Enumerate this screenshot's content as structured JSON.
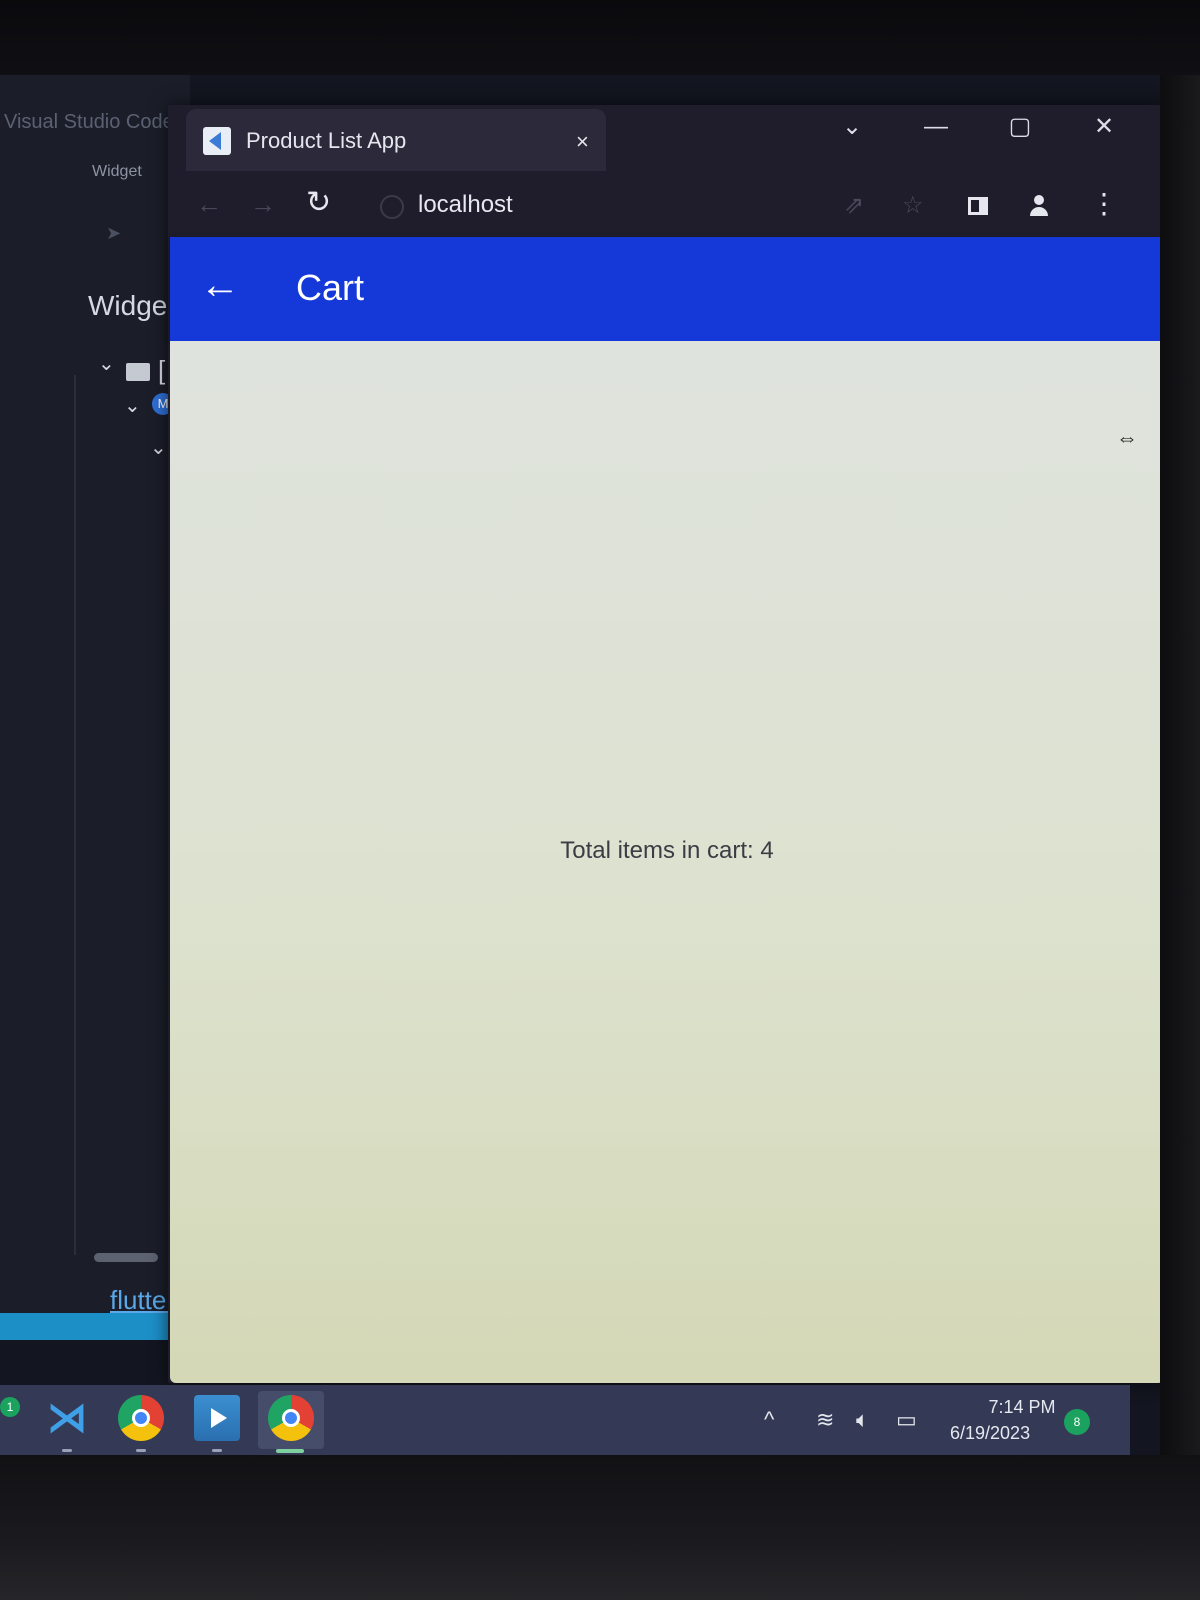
{
  "vscode": {
    "title": "Visual Studio Code",
    "tab": "Widget",
    "panel_heading": "Widge",
    "tree_badge": "M",
    "link": "flutter"
  },
  "browser": {
    "tab_title": "Product List App",
    "tab_close": "×",
    "url": "localhost",
    "icons": {
      "reload": "↻",
      "back": "←",
      "forward": "→",
      "share": "⇗",
      "star": "☆",
      "menu": "⋮",
      "chevron": "⌄",
      "minimize": "—",
      "maximize": "▢",
      "close": "✕"
    }
  },
  "app": {
    "title": "Cart",
    "back_icon": "←",
    "cart_text": "Total items in cart: 4",
    "accent_color": "#1538d8"
  },
  "taskbar": {
    "badge": "1",
    "tray_chevron": "^",
    "time": "7:14 PM",
    "date": "6/19/2023",
    "notifications": "8"
  }
}
